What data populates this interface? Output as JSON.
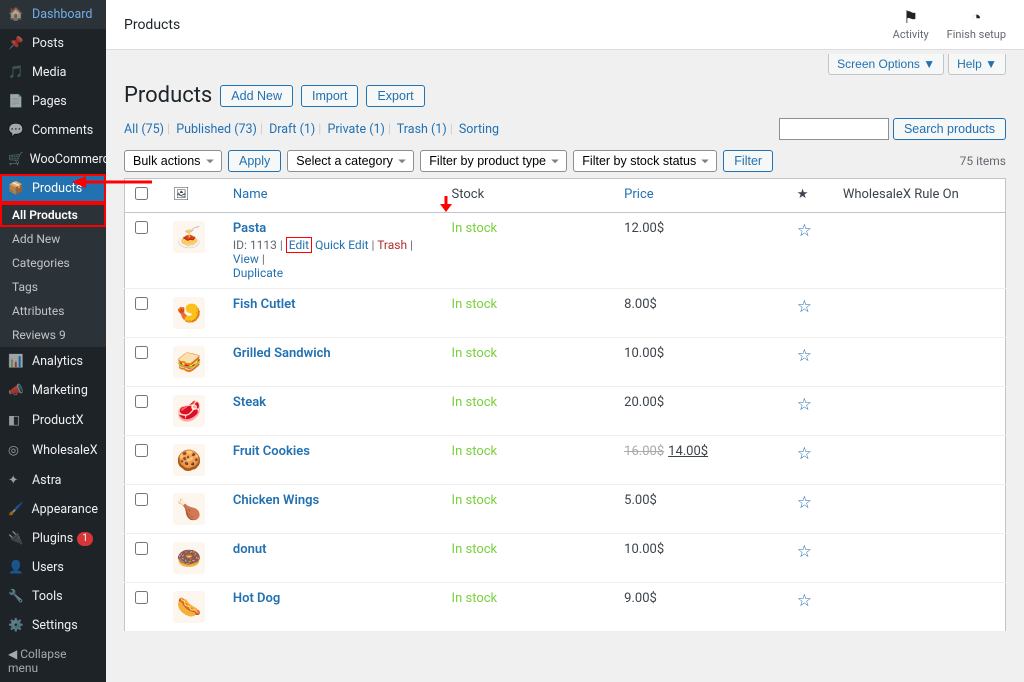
{
  "sidebar": {
    "items": [
      {
        "label": "Dashboard"
      },
      {
        "label": "Posts"
      },
      {
        "label": "Media"
      },
      {
        "label": "Pages"
      },
      {
        "label": "Comments"
      },
      {
        "label": "WooCommerce"
      },
      {
        "label": "Products"
      },
      {
        "label": "Analytics"
      },
      {
        "label": "Marketing"
      },
      {
        "label": "ProductX"
      },
      {
        "label": "WholesaleX"
      },
      {
        "label": "Astra"
      },
      {
        "label": "Appearance"
      },
      {
        "label": "Plugins"
      },
      {
        "label": "Users"
      },
      {
        "label": "Tools"
      },
      {
        "label": "Settings"
      }
    ],
    "products_submenu": [
      {
        "label": "All Products"
      },
      {
        "label": "Add New"
      },
      {
        "label": "Categories"
      },
      {
        "label": "Tags"
      },
      {
        "label": "Attributes"
      },
      {
        "label": "Reviews"
      }
    ],
    "plugins_badge": "1",
    "reviews_badge": "9",
    "collapse": "Collapse menu"
  },
  "topbar": {
    "title": "Products",
    "activity": "Activity",
    "finish": "Finish setup"
  },
  "screenopts": {
    "screen": "Screen Options",
    "help": "Help"
  },
  "heading": {
    "title": "Products",
    "add": "Add New",
    "import": "Import",
    "export": "Export"
  },
  "statuslinks": {
    "all": "All",
    "all_n": "(75)",
    "pub": "Published",
    "pub_n": "(73)",
    "draft": "Draft",
    "draft_n": "(1)",
    "priv": "Private",
    "priv_n": "(1)",
    "trash": "Trash",
    "trash_n": "(1)",
    "sort": "Sorting"
  },
  "search_btn": "Search products",
  "bulk": {
    "bulk_select": "Bulk actions",
    "apply": "Apply",
    "cat": "Select a category",
    "type": "Filter by product type",
    "stock": "Filter by stock status",
    "filter": "Filter",
    "count": "75 items"
  },
  "cols": {
    "img": "",
    "name": "Name",
    "stock": "Stock",
    "price": "Price",
    "star": "★",
    "rule": "WholesaleX Rule On"
  },
  "rows": [
    {
      "name": "Pasta",
      "thumb": "🍝",
      "id": "ID: 1113",
      "stock": "In stock",
      "price": "12.00$",
      "sale": ""
    },
    {
      "name": "Fish Cutlet",
      "thumb": "🍤",
      "stock": "In stock",
      "price": "8.00$",
      "sale": ""
    },
    {
      "name": "Grilled Sandwich",
      "thumb": "🥪",
      "stock": "In stock",
      "price": "10.00$",
      "sale": ""
    },
    {
      "name": "Steak",
      "thumb": "🥩",
      "stock": "In stock",
      "price": "20.00$",
      "sale": ""
    },
    {
      "name": "Fruit Cookies",
      "thumb": "🍪",
      "stock": "In stock",
      "price": "16.00$",
      "sale": "14.00$"
    },
    {
      "name": "Chicken Wings",
      "thumb": "🍗",
      "stock": "In stock",
      "price": "5.00$",
      "sale": ""
    },
    {
      "name": "donut",
      "thumb": "🍩",
      "stock": "In stock",
      "price": "10.00$",
      "sale": ""
    },
    {
      "name": "Hot Dog",
      "thumb": "🌭",
      "stock": "In stock",
      "price": "9.00$",
      "sale": ""
    }
  ],
  "rowactions": {
    "edit": "Edit",
    "quick": "Quick Edit",
    "trash": "Trash",
    "view": "View",
    "dup": "Duplicate"
  }
}
